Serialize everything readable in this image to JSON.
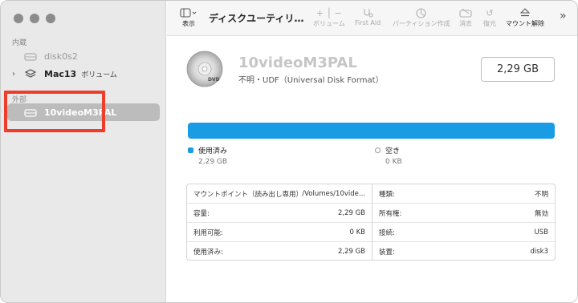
{
  "sidebar": {
    "internal_label": "内蔵",
    "external_label": "外部",
    "items": [
      {
        "label": "disk0s2",
        "sub": ""
      },
      {
        "label": "Mac13",
        "sub": "ボリューム"
      },
      {
        "label": "10videoM3PAL",
        "sub": ""
      }
    ]
  },
  "toolbar": {
    "view_label": "表示",
    "title": "ディスクユーティリ…",
    "volume_label": "ボリューム",
    "first_aid_label": "First Aid",
    "partition_label": "パーティション作成",
    "erase_label": "消去",
    "restore_label": "復元",
    "mount_label": "マウント解除"
  },
  "volume": {
    "name": "10videoM3PAL",
    "description": "不明・UDF（Universal Disk Format）",
    "size": "2,29 GB"
  },
  "usage": {
    "used_label": "使用済み",
    "used_value": "2,29 GB",
    "free_label": "空き",
    "free_value": "0 KB",
    "used_fraction": 1.0,
    "used_color": "#1a9ce5"
  },
  "info": {
    "left": [
      {
        "key": "マウントポイント（読み出し専用）:",
        "value": "/Volumes/10vide..."
      },
      {
        "key": "容量:",
        "value": "2,29 GB"
      },
      {
        "key": "利用可能:",
        "value": "0 KB"
      },
      {
        "key": "使用済み:",
        "value": "2,29 GB"
      }
    ],
    "right": [
      {
        "key": "種類:",
        "value": "不明"
      },
      {
        "key": "所有権:",
        "value": "無効"
      },
      {
        "key": "接続:",
        "value": "USB"
      },
      {
        "key": "装置:",
        "value": "disk3"
      }
    ]
  },
  "icons": {
    "sidebar_toggle": "sidebar-icon",
    "disk": "drive-icon",
    "dvd": "dvd-disc-icon"
  }
}
